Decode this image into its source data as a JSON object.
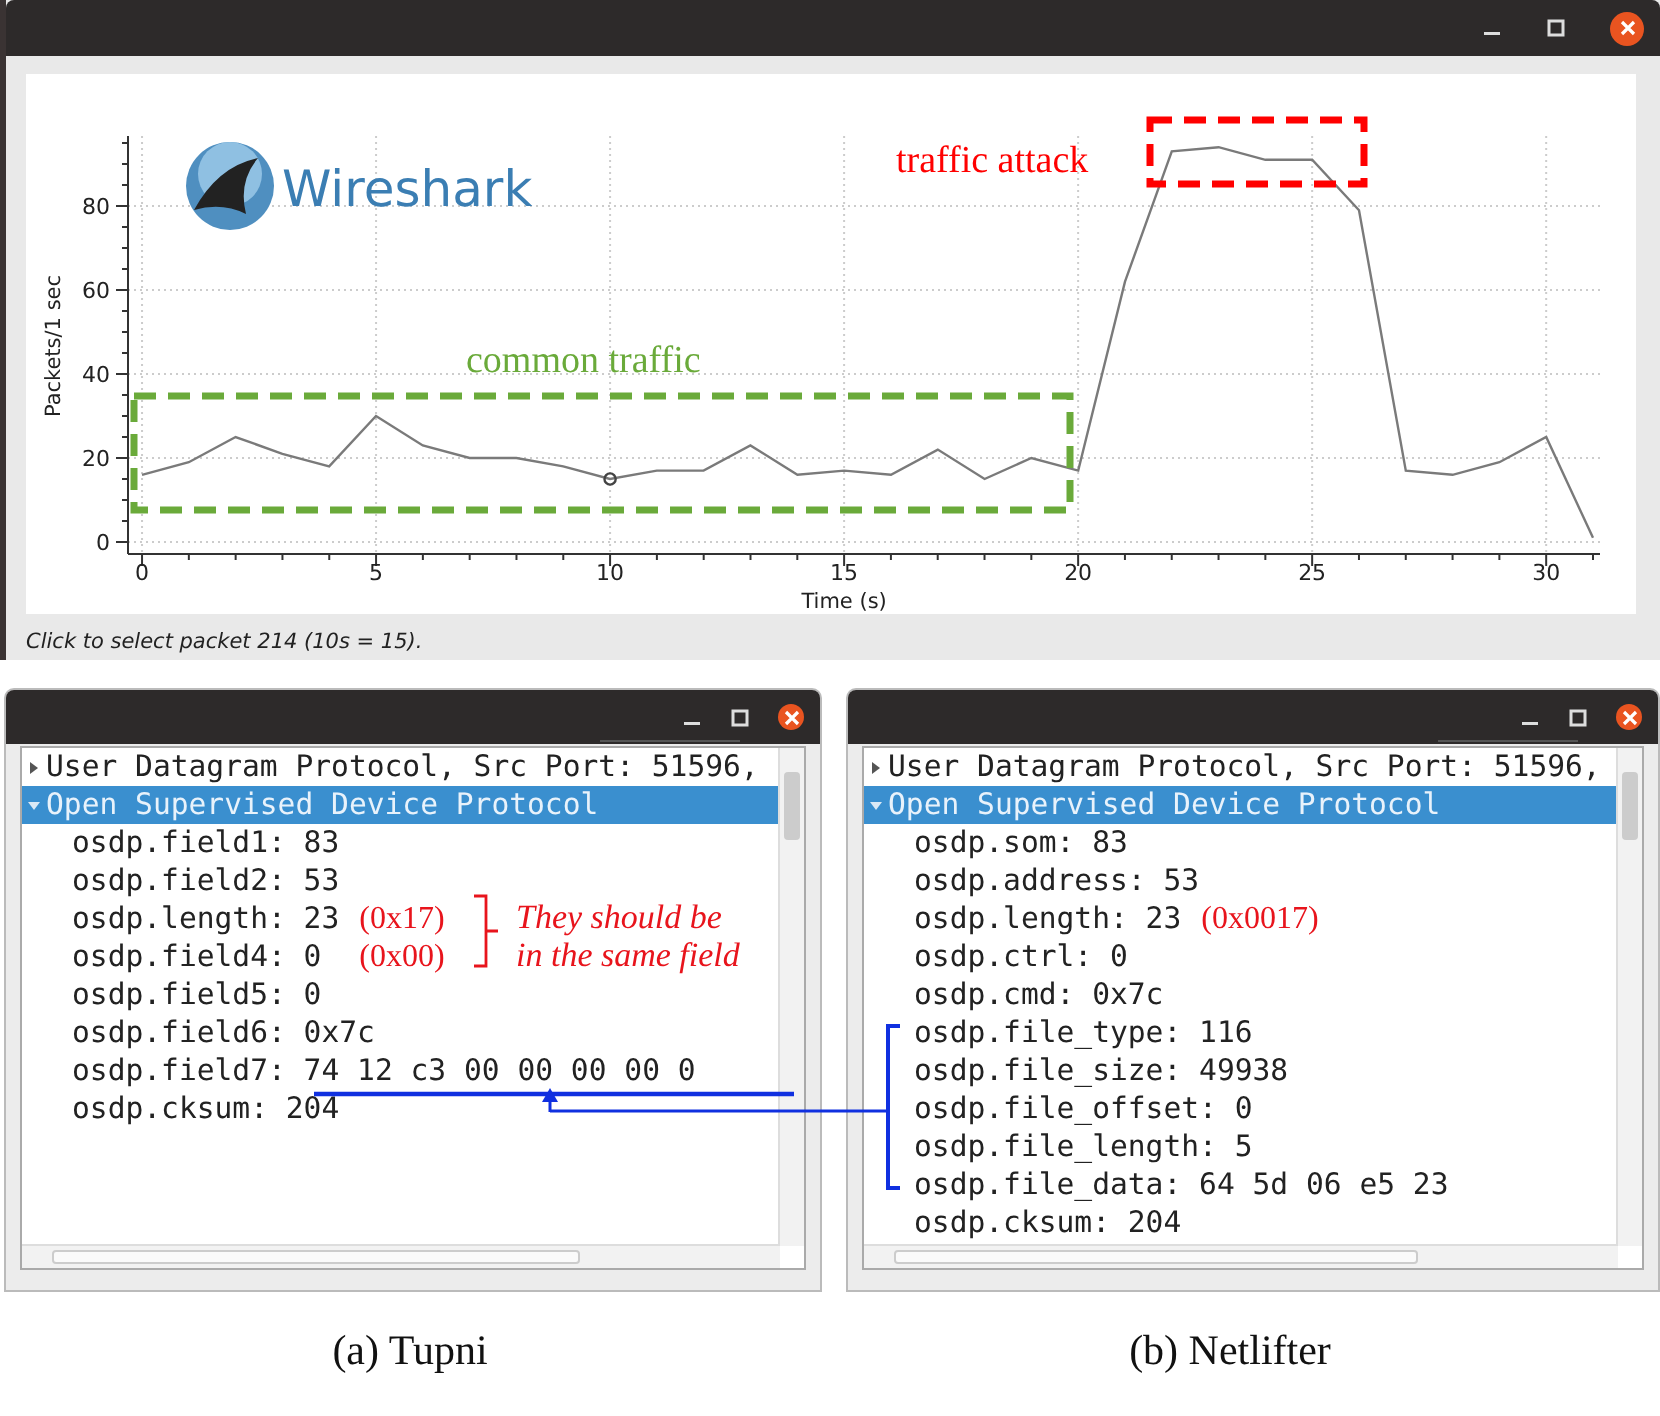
{
  "graph_window": {
    "logo": "Wireshark",
    "chart_data": {
      "type": "line",
      "xlabel": "Time (s)",
      "ylabel": "Packets/1 sec",
      "x": [
        0,
        1,
        2,
        3,
        4,
        5,
        6,
        7,
        8,
        9,
        10,
        11,
        12,
        13,
        14,
        15,
        16,
        17,
        18,
        19,
        20,
        21,
        22,
        23,
        24,
        25,
        26,
        27,
        28,
        29,
        30,
        31
      ],
      "series": [
        {
          "color": "#7a7a7a",
          "values": [
            16,
            19,
            25,
            21,
            18,
            30,
            23,
            20,
            20,
            18,
            15,
            17,
            17,
            23,
            16,
            17,
            16,
            22,
            15,
            20,
            17,
            62,
            93,
            94,
            91,
            91,
            79,
            17,
            16,
            19,
            25,
            1
          ]
        }
      ],
      "xticks": [
        0,
        5,
        10,
        15,
        20,
        25,
        30
      ],
      "yticks": [
        0,
        20,
        40,
        60,
        80
      ],
      "xlim": [
        -0.3,
        31.15
      ],
      "ylim": [
        -2.86,
        96.67
      ],
      "grid": true
    },
    "selected_point": "10",
    "highlights": [
      {
        "label": "traffic attack",
        "color": "#ff0000"
      },
      {
        "label": "common traffic",
        "color": "#6aaa3a"
      }
    ],
    "status": "Click to select packet 214 (10s = 15)."
  },
  "panels": [
    {
      "caption": "(a) Tupni",
      "comment": "They should be\nin the same field",
      "rows": [
        {
          "text": "User Datagram Protocol, Src Port: 51596,",
          "expanded": false,
          "selected": false
        },
        {
          "text": "Open Supervised Device Protocol",
          "expanded": true,
          "selected": true,
          "children": [
            {
              "text": "osdp.field1: 83",
              "selected": false
            },
            {
              "text": "osdp.field2: 53",
              "selected": false
            },
            {
              "text": "osdp.length: 23",
              "selected": false,
              "note": "(0x17)"
            },
            {
              "text": "osdp.field4: 0",
              "selected": false,
              "note": "(0x00)"
            },
            {
              "text": "osdp.field5: 0",
              "selected": false
            },
            {
              "text": "osdp.field6: 0x7c",
              "selected": false
            },
            {
              "text": "osdp.field7: 74 12 c3 00 00 00 00 0",
              "selected": false
            },
            {
              "text": "osdp.cksum: 204",
              "selected": false
            }
          ]
        }
      ]
    },
    {
      "caption": "(b) Netlifter",
      "rows": [
        {
          "text": "User Datagram Protocol, Src Port: 51596,",
          "expanded": false,
          "selected": false
        },
        {
          "text": "Open Supervised Device Protocol",
          "expanded": true,
          "selected": true,
          "children": [
            {
              "text": "osdp.som: 83",
              "selected": false
            },
            {
              "text": "osdp.address: 53",
              "selected": false
            },
            {
              "text": "osdp.length: 23",
              "selected": false,
              "note": "(0x0017)"
            },
            {
              "text": "osdp.ctrl: 0",
              "selected": false
            },
            {
              "text": "osdp.cmd: 0x7c",
              "selected": false
            },
            {
              "text": "osdp.file_type: 116",
              "selected": false
            },
            {
              "text": "osdp.file_size: 49938",
              "selected": false
            },
            {
              "text": "osdp.file_offset: 0",
              "selected": false
            },
            {
              "text": "osdp.file_length: 5",
              "selected": false
            },
            {
              "text": "osdp.file_data: 64 5d 06 e5 23",
              "selected": false
            },
            {
              "text": "osdp.cksum: 204",
              "selected": false
            }
          ]
        }
      ]
    }
  ]
}
